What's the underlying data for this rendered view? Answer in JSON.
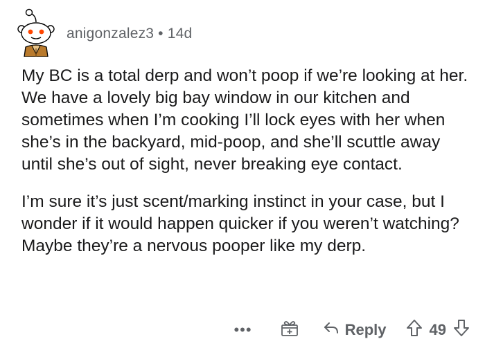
{
  "comment": {
    "username": "anigonzalez3",
    "separator": "•",
    "age": "14d",
    "paragraphs": [
      "My BC is a total derp and won’t poop if we’re looking at her. We have a lovely big bay window in our kitchen  and sometimes when I’m cooking I’ll lock eyes with her when she’s in the backyard, mid-poop, and she’ll scuttle away until she’s out of sight, never breaking eye contact.",
      "I’m sure it’s just scent/marking instinct in your case, but I wonder if it would happen quicker if you weren’t watching? Maybe they’re a nervous pooper like my derp."
    ]
  },
  "actions": {
    "more_label": "•••",
    "reply_label": "Reply",
    "score": "49"
  },
  "icons": {
    "avatar": "reddit-snoo-avatar",
    "gift": "gift-icon",
    "reply": "reply-arrow-icon",
    "upvote": "upvote-arrow-icon",
    "downvote": "downvote-arrow-icon"
  },
  "colors": {
    "text": "#1a1a1b",
    "meta": "#5f6266"
  }
}
